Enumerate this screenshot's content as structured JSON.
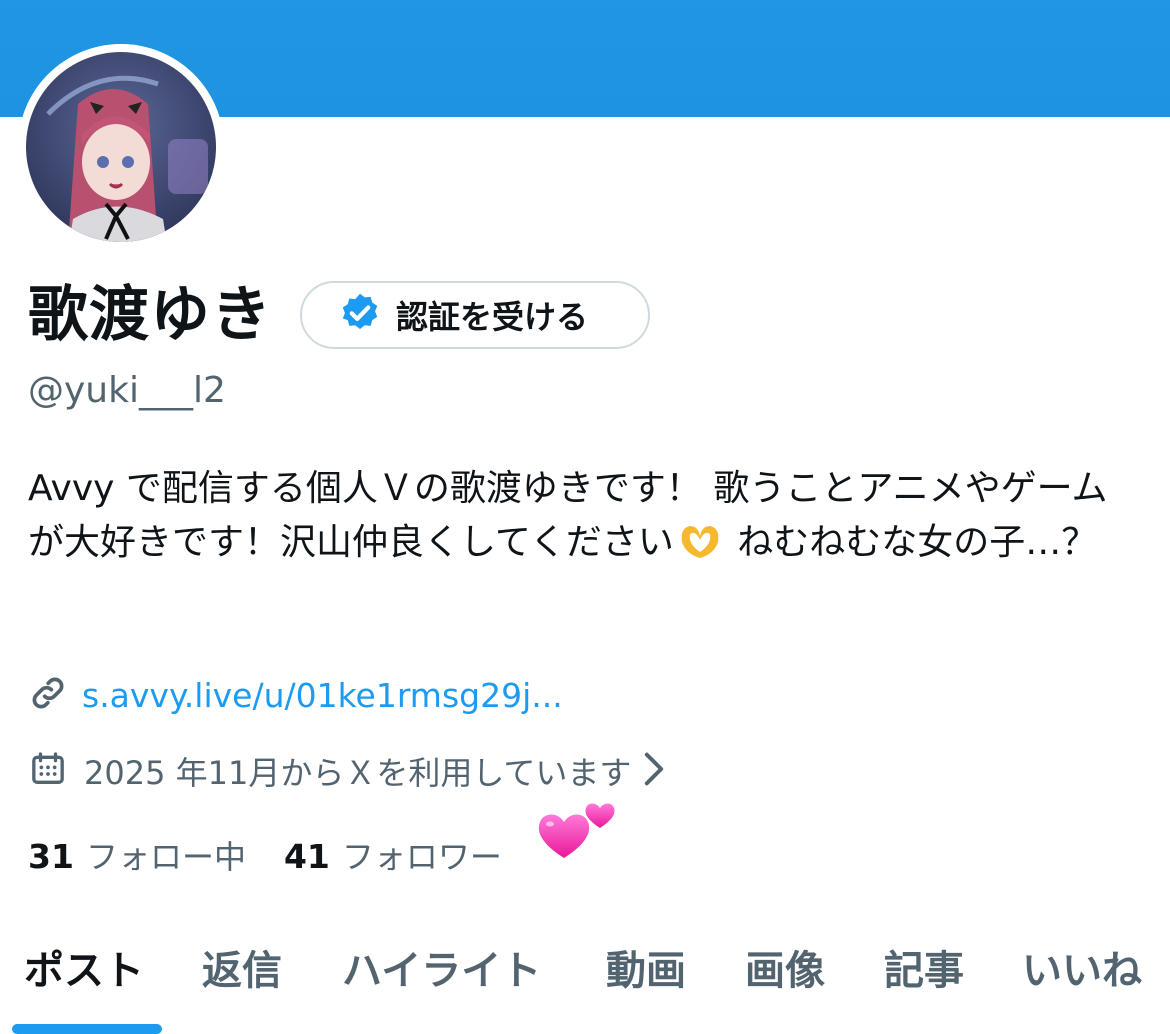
{
  "profile": {
    "display_name": "歌渡ゆき",
    "handle": "@yuki___l2",
    "verify_button_label": "認証を受ける",
    "bio_part1": "Avvy で配信する個人Ｖの歌渡ゆきです！ 歌うことアニメやゲームが大好きです！沢山仲良くしてください",
    "bio_part2": " ねむねむな女の子…？",
    "link": "s.avvy.live/u/01ke1rmsg29j...",
    "joined": "2025 年11月からＸを利用しています",
    "following_count": "31",
    "following_label": "フォロー中",
    "followers_count": "41",
    "followers_label": "フォロワー"
  },
  "tabs": [
    {
      "label": "ポスト",
      "active": true
    },
    {
      "label": "返信"
    },
    {
      "label": "ハイライト"
    },
    {
      "label": "動画"
    },
    {
      "label": "画像"
    },
    {
      "label": "記事"
    },
    {
      "label": "いいね"
    }
  ],
  "colors": {
    "banner": "#1d93e1",
    "accent": "#1d9bf0",
    "text": "#0f1419",
    "secondary_text": "#536471"
  },
  "icons": [
    "verified-badge-icon",
    "link-icon",
    "calendar-icon",
    "chevron-right-icon",
    "heart-hands-emoji",
    "two-hearts-emoji"
  ]
}
